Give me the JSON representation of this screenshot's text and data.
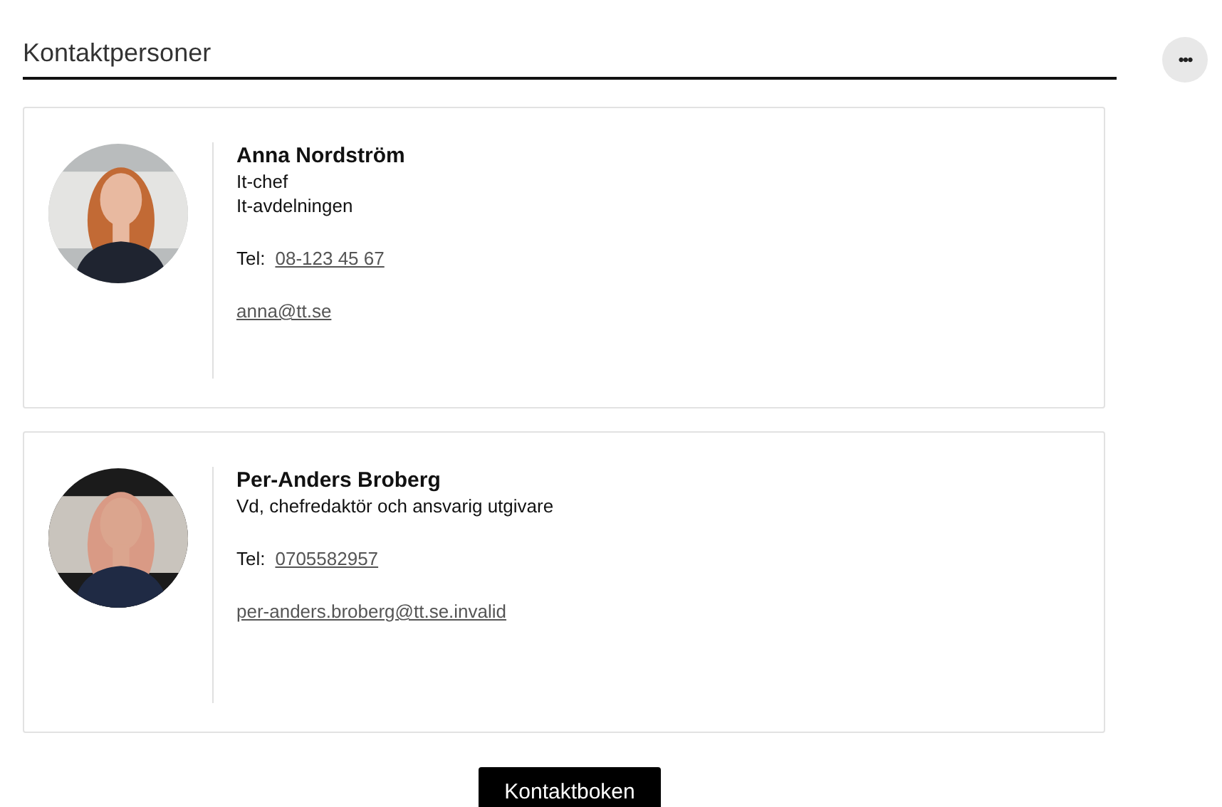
{
  "header": {
    "title": "Kontaktpersoner",
    "menu_icon": "•••"
  },
  "contacts": [
    {
      "name": "Anna Nordström",
      "details": [
        "It-chef",
        "It-avdelningen"
      ],
      "tel_label": "Tel:",
      "phone": "08-123 45 67",
      "email": "anna@tt.se"
    },
    {
      "name": "Per-Anders Broberg",
      "details": [
        "Vd, chefredaktör och ansvarig utgivare"
      ],
      "tel_label": "Tel:",
      "phone": "0705582957",
      "email": "per-anders.broberg@tt.se.invalid"
    }
  ],
  "button": {
    "label": "Kontaktboken"
  }
}
